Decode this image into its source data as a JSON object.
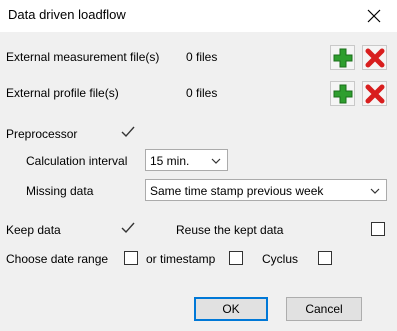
{
  "window": {
    "title": "Data driven loadflow"
  },
  "external_measurement": {
    "label": "External measurement file(s)",
    "count": "0 files"
  },
  "external_profile": {
    "label": "External profile file(s)",
    "count": "0 files"
  },
  "preprocessor": {
    "label": "Preprocessor",
    "checked": true,
    "calculation_interval": {
      "label": "Calculation interval",
      "value": "15 min."
    },
    "missing_data": {
      "label": "Missing data",
      "value": "Same time stamp previous week"
    }
  },
  "keep_data": {
    "label": "Keep data",
    "checked": true
  },
  "reuse_kept_data": {
    "label": "Reuse the kept data",
    "checked": false
  },
  "choose_date_range": {
    "label": "Choose date range",
    "checked": false
  },
  "or_timestamp": {
    "label": "or timestamp",
    "checked": false
  },
  "cyclus": {
    "label": "Cyclus",
    "checked": false
  },
  "buttons": {
    "ok": "OK",
    "cancel": "Cancel"
  },
  "colors": {
    "add_icon": "#2e9e2e",
    "remove_icon": "#d81e1e",
    "default_button_border": "#0078d7"
  }
}
